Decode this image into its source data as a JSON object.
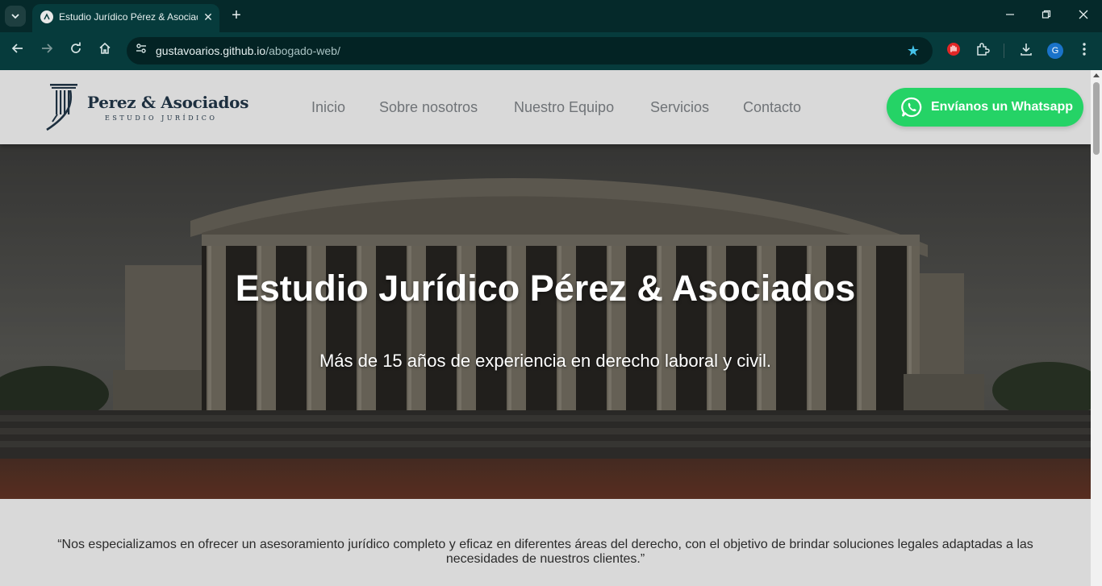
{
  "browser": {
    "tab_title": "Estudio Jurídico Pérez & Asociados",
    "new_tab": "+",
    "url_host": "gustavoarios.github.io",
    "url_path": "/abogado-web/",
    "profile_initial": "G",
    "accent_color": "#45c3ea"
  },
  "header": {
    "logo_name": "Perez & Asociados",
    "logo_sub": "ESTUDIO JURÍDICO",
    "nav": [
      "Inicio",
      "Sobre nosotros",
      "Nuestro Equipo",
      "Servicios",
      "Contacto"
    ],
    "whatsapp_label": "Envíanos un Whatsapp",
    "whatsapp_color": "#25d366"
  },
  "hero": {
    "title": "Estudio Jurídico Pérez & Asociados",
    "subtitle": "Más de 15 años de experiencia en derecho laboral y civil."
  },
  "intro": {
    "quote": "“Nos especializamos en ofrecer un asesoramiento jurídico completo y eficaz en diferentes áreas del derecho, con el objetivo de brindar soluciones legales adaptadas a las necesidades de nuestros clientes.”"
  }
}
